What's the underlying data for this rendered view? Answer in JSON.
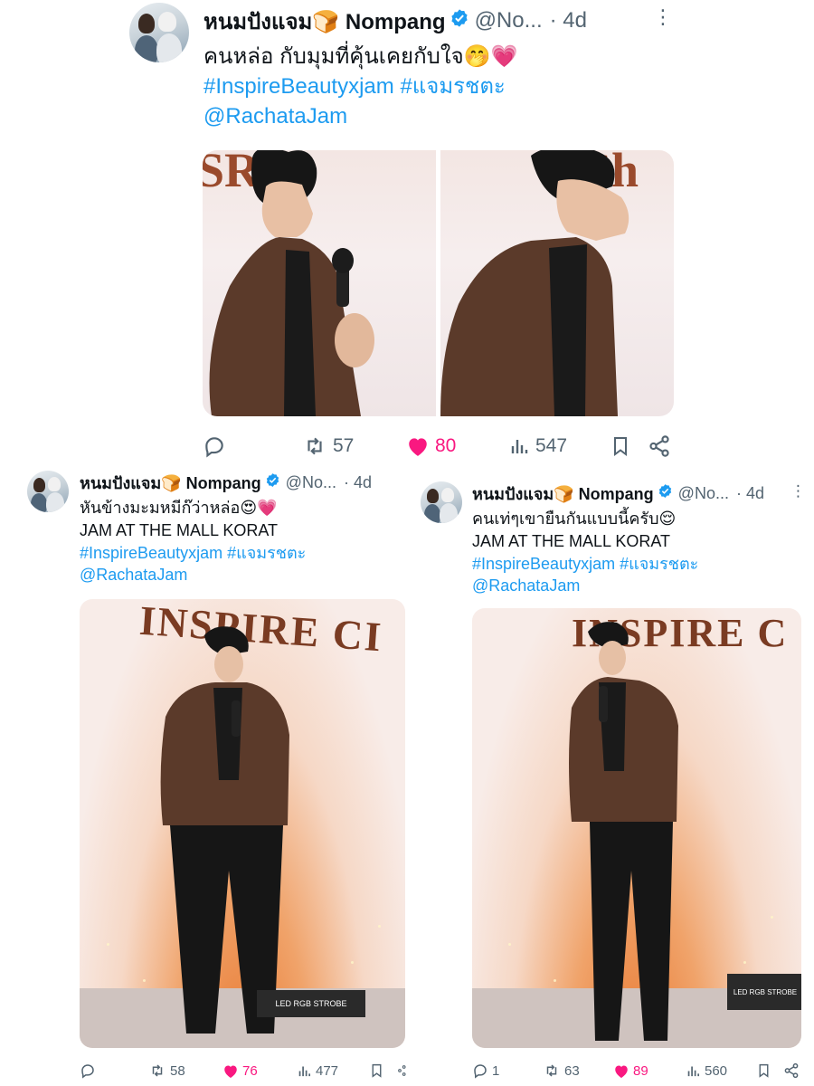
{
  "tweets": [
    {
      "author": {
        "name": "หนมปังแจม🍞 Nompang",
        "handle": "@No...",
        "verified": true
      },
      "time": "4d",
      "text": "คนหล่อ กับมุมที่คุ้นเคยกับใจ🤭💗",
      "hashtags": "#InspireBeautyxjam #แจมรชตะ",
      "mention": "@RachataJam",
      "stats": {
        "replies": "",
        "retweets": "57",
        "likes": "80",
        "views": "547"
      },
      "like_active": true
    },
    {
      "author": {
        "name": "หนมปังแจม🍞 Nompang",
        "handle": "@No...",
        "verified": true
      },
      "time": "4d",
      "text": "หันข้างมะมหมีก๊ว่าหล่อ😍💗",
      "text2": "JAM AT THE MALL KORAT",
      "hashtags": "#InspireBeautyxjam #แจมรชตะ",
      "mention": "@RachataJam",
      "media_banner": "INSPIRE CI",
      "stats": {
        "replies": "",
        "retweets": "58",
        "likes": "76",
        "views": "477"
      },
      "like_active": true
    },
    {
      "author": {
        "name": "หนมปังแจม🍞 Nompang",
        "handle": "@No...",
        "verified": true
      },
      "time": "4d",
      "text": "คนเท่ๆเขายืนกันแบบนี้ครับ😌",
      "text2": "JAM AT THE MALL KORAT",
      "hashtags": "#InspireBeautyxjam #แจมรชตะ",
      "mention": "@RachataJam",
      "media_banner": "INSPIRE C",
      "stats": {
        "replies": "1",
        "retweets": "63",
        "likes": "89",
        "views": "560"
      },
      "like_active": true
    }
  ],
  "equipment_label": "LED RGB STROBE",
  "colors": {
    "link": "#1d9bf0",
    "like": "#f91880",
    "muted": "#536471",
    "verified": "#1d9bf0"
  }
}
